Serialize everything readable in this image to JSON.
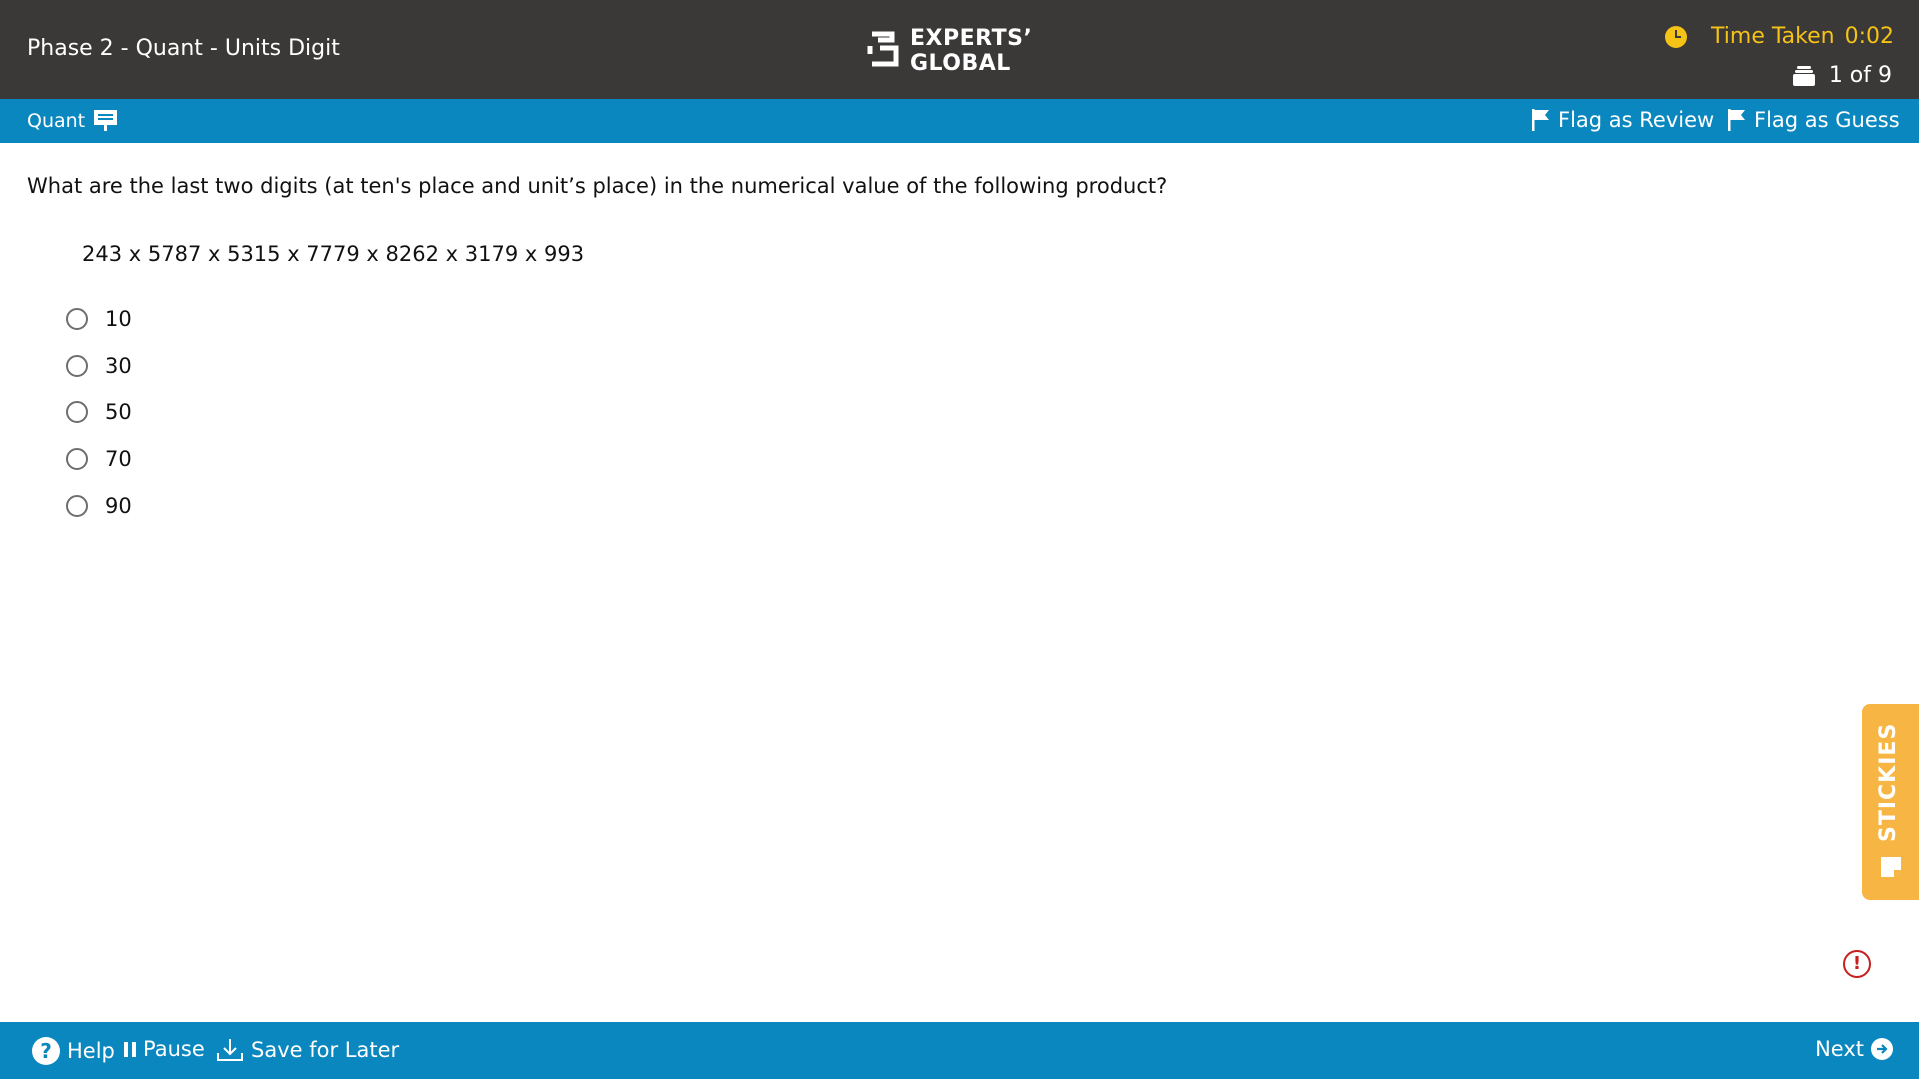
{
  "header": {
    "title": "Phase 2 - Quant - Units Digit",
    "logo_line1": "EXPERTS’",
    "logo_line2": "GLOBAL",
    "timer_label": "Time Taken",
    "timer_value": "0:02",
    "question_counter": "1 of 9"
  },
  "section_bar": {
    "section_name": "Quant",
    "flag_review_label": "Flag as Review",
    "flag_guess_label": "Flag as Guess"
  },
  "question": {
    "text": "What are the last two digits (at ten's place and unit’s place) in the numerical value of the following product?",
    "expression": "243 x 5787 x 5315 x 7779 x 8262 x 3179 x 993",
    "options": [
      "10",
      "30",
      "50",
      "70",
      "90"
    ],
    "selected_option": null
  },
  "side": {
    "stickies_label": "STICKIES",
    "alert_symbol": "!"
  },
  "footer": {
    "help_label": "Help",
    "pause_label": "Pause",
    "save_label": "Save for Later",
    "next_label": "Next"
  },
  "colors": {
    "header_bg": "#3b3838",
    "accent_blue": "#0b87bf",
    "timer_yellow": "#f5c216",
    "stickies_orange": "#f7b543",
    "alert_red": "#c81e1e"
  }
}
